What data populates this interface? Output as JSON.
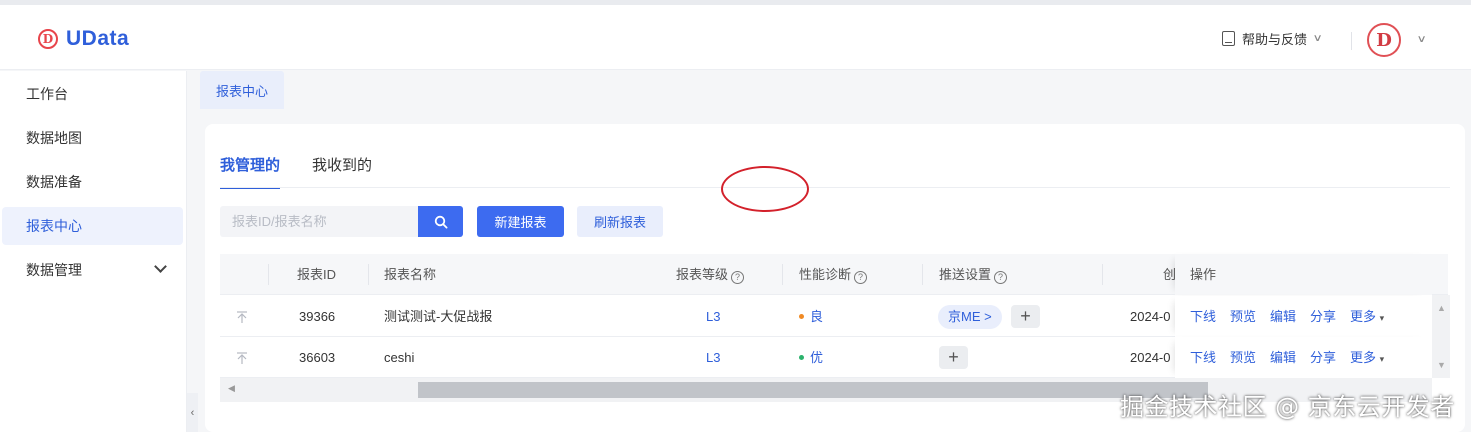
{
  "app": {
    "logo_text": "UData",
    "logo_letter": "D"
  },
  "header": {
    "help_label": "帮助与反馈",
    "avatar_letter": "D"
  },
  "sidebar": {
    "items": [
      {
        "label": "工作台"
      },
      {
        "label": "数据地图"
      },
      {
        "label": "数据准备"
      },
      {
        "label": "报表中心",
        "active": true
      },
      {
        "label": "数据管理",
        "expandable": true
      }
    ]
  },
  "tabs": {
    "open_tab": "报表中心"
  },
  "subtabs": [
    {
      "label": "我管理的",
      "active": true
    },
    {
      "label": "我收到的"
    }
  ],
  "toolbar": {
    "search_placeholder": "报表ID/报表名称",
    "new_report_label": "新建报表",
    "refresh_label": "刷新报表"
  },
  "table": {
    "columns": {
      "id": "报表ID",
      "name": "报表名称",
      "level": "报表等级",
      "diagnosis": "性能诊断",
      "push": "推送设置",
      "created": "创",
      "ops": "操作"
    },
    "help_glyph": "?",
    "rows": [
      {
        "id": "39366",
        "name": "测试测试-大促战报",
        "level": "L3",
        "diagnosis": "良",
        "diagnosis_color": "#f08a24",
        "push_tag": "京ME >",
        "created": "2024-0",
        "ops": [
          "下线",
          "预览",
          "编辑",
          "分享",
          "更多"
        ]
      },
      {
        "id": "36603",
        "name": "ceshi",
        "level": "L3",
        "diagnosis": "优",
        "diagnosis_color": "#2bb26c",
        "push_tag": "",
        "created": "2024-0",
        "ops": [
          "下线",
          "预览",
          "编辑",
          "分享",
          "更多"
        ]
      }
    ],
    "plus_glyph": "+"
  },
  "watermark": "掘金技术社区 @ 京东云开发者",
  "colors": {
    "primary": "#3d6bf0",
    "brand": "#2f5fda",
    "annotation": "#d3212b"
  }
}
